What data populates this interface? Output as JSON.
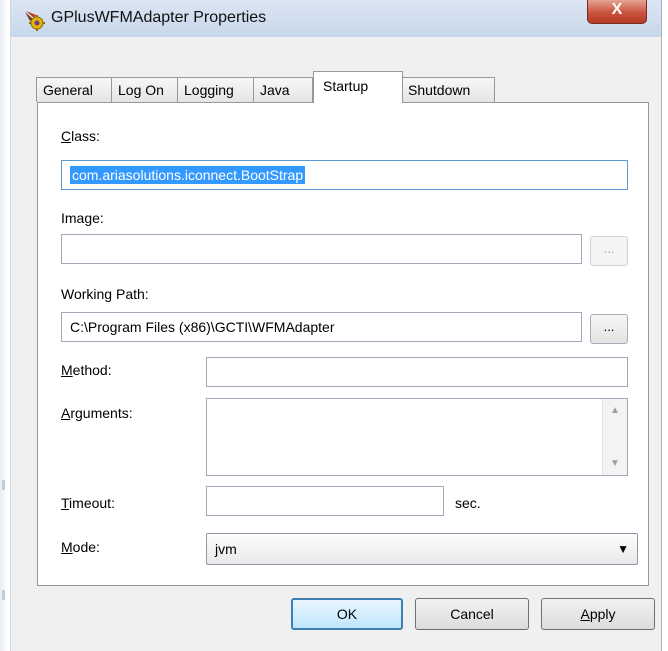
{
  "window": {
    "title": "GPlusWFMAdapter Properties",
    "close_glyph": "X"
  },
  "tabs": [
    {
      "label": "General"
    },
    {
      "label": "Log On"
    },
    {
      "label": "Logging"
    },
    {
      "label": "Java"
    },
    {
      "label": "Startup",
      "active": true
    },
    {
      "label": "Shutdown"
    }
  ],
  "startup": {
    "class": {
      "label_key": "C",
      "label_rest": "lass:",
      "value": "com.ariasolutions.iconnect.BootStrap"
    },
    "image": {
      "label": "Image:",
      "value": "",
      "browse_label": "..."
    },
    "working_path": {
      "label": "Working Path:",
      "value": "C:\\Program Files (x86)\\GCTI\\WFMAdapter",
      "browse_label": "..."
    },
    "method": {
      "label_key": "M",
      "label_rest": "ethod:",
      "value": ""
    },
    "arguments": {
      "label_key": "A",
      "label_rest": "rguments:",
      "value": ""
    },
    "timeout": {
      "label_key": "T",
      "label_rest": "imeout:",
      "value": "",
      "unit": "sec."
    },
    "mode": {
      "label_key": "M",
      "label_rest": "ode:",
      "value": "jvm"
    }
  },
  "buttons": {
    "ok": "OK",
    "cancel": "Cancel",
    "apply_key": "A",
    "apply_rest": "pply"
  },
  "icons": {
    "app": "service-gear-icon",
    "close": "close-icon",
    "dropdown": "chevron-down-icon",
    "scroll_up": "scroll-up-arrow-icon",
    "scroll_down": "scroll-down-arrow-icon"
  },
  "colors": {
    "close_red": "#c9533e",
    "selection": "#3399ff",
    "default_button_border": "#3c7fb1"
  }
}
